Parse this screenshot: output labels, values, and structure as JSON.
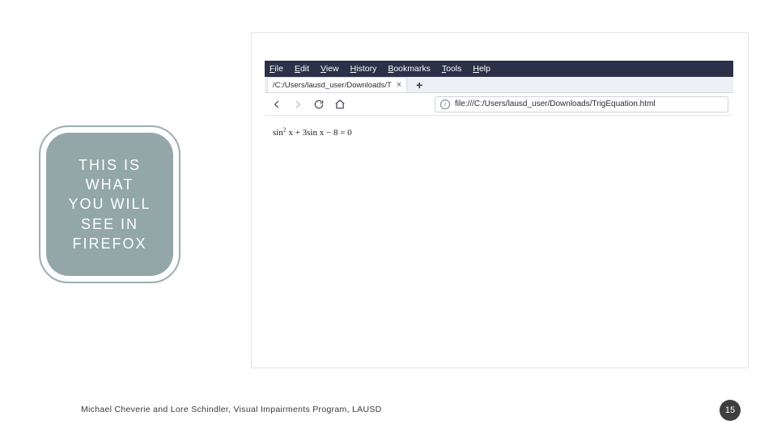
{
  "callout": {
    "text": "THIS IS\nWHAT\nYOU WILL\nSEE IN\nFIREFOX"
  },
  "firefox": {
    "menu": [
      "File",
      "Edit",
      "View",
      "History",
      "Bookmarks",
      "Tools",
      "Help"
    ],
    "tab": {
      "title": "/C:/Users/lausd_user/Downloads/T",
      "close": "×"
    },
    "newtab_glyph": "+",
    "address": "file:///C:/Users/lausd_user/Downloads/TrigEquation.html",
    "info_glyph": "i"
  },
  "equation": {
    "term1_base": "sin",
    "term1_exp": "2",
    "term1_var": "x",
    "plus": " + ",
    "term2": "3sin x",
    "minus": " − ",
    "term3": "8",
    "eq": " = 0"
  },
  "footer": {
    "credit": "Michael Cheverie and Lore Schindler, Visual Impairments Program, LAUSD",
    "page": "15"
  }
}
